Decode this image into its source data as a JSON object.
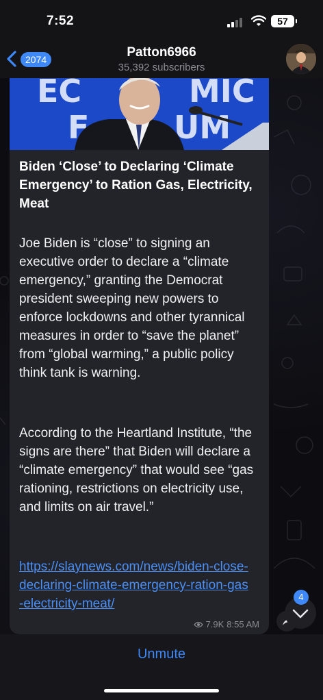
{
  "status_bar": {
    "time": "7:52",
    "battery": "57"
  },
  "header": {
    "unread_count": "2074",
    "channel_name": "Patton6966",
    "subscribers": "35,392 subscribers"
  },
  "message": {
    "title": "Biden ‘Close’ to Declaring ‘Climate Emergency’ to Ration Gas, Electricity, Meat",
    "paragraph1": "Joe Biden is “close” to signing an executive order to declare a “climate emergency,” granting the Democrat president sweeping new powers to enforce lockdowns and other tyrannical measures in order to “save the planet” from “global warming,” a public policy think tank is warning.",
    "paragraph2": "According to the Heartland Institute, “the signs are there” that Biden will declare a “climate emergency” that would see “gas rationing, restrictions on electricity use, and limits on air travel.”",
    "link": "https://slaynews.com/news/biden-close-declaring-climate-emergency-ration-gas-electricity-meat/",
    "views": "7.9K",
    "time": "8:55 AM",
    "hero_text": "ECONOMIC FORUM"
  },
  "scroll_down_badge": "4",
  "bottom": {
    "unmute_label": "Unmute"
  },
  "colors": {
    "accent": "#3e88f7",
    "link": "#4a8ff5",
    "bubble": "#23232a",
    "hero_bg": "#1b49c7"
  },
  "icons": [
    "back-chevron-icon",
    "signal-icon",
    "wifi-icon",
    "battery-icon",
    "eye-icon",
    "chevron-down-icon",
    "share-icon"
  ]
}
